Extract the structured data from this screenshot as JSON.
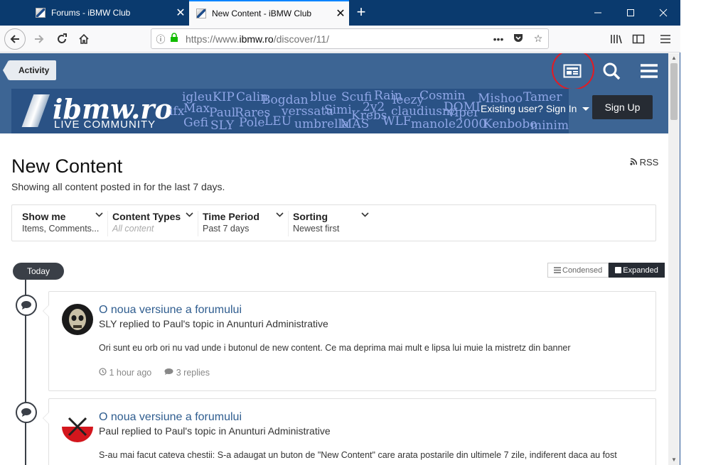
{
  "browser": {
    "tabs": [
      {
        "title": "Forums - iBMW Club",
        "close": "✕"
      },
      {
        "title": "New Content - iBMW Club",
        "close": "✕"
      }
    ],
    "new_tab": "+",
    "window_controls": {
      "minimize": "—",
      "maximize": "☐",
      "close": "✕"
    },
    "url_prefix": "https://www.",
    "url_domain": "ibmw.ro",
    "url_path": "/discover/11/",
    "url_actions": "•••"
  },
  "site": {
    "activity_label": "Activity",
    "logo_text": "ibmw.ro",
    "logo_sub": "LIVE COMMUNITY",
    "nicks": [
      "igleu",
      "KIP",
      "Calin",
      "Bogdan",
      "blue",
      "Scufi",
      "Rain",
      "leezy",
      "Cosmin",
      "Mishoo",
      "Tamer",
      "ifx",
      "Max",
      "Paul",
      "Rares",
      "verssatu",
      "Simi",
      "2y2",
      "claudiusnc",
      "DOMI",
      "viper",
      "Gefi",
      "SLY",
      "Pole",
      "LEU",
      "umbrella",
      "MAS",
      "Krebs",
      "WLF",
      "manole2000",
      "Kenbobo",
      "minima"
    ],
    "signin_label": "Existing user? Sign In",
    "signup_label": "Sign Up"
  },
  "page": {
    "title": "New Content",
    "subtitle": "Showing all content posted in for the last 7 days.",
    "rss_label": "RSS",
    "filters": [
      {
        "title": "Show me",
        "value": "Items, Comments..."
      },
      {
        "title": "Content Types",
        "value": "All content"
      },
      {
        "title": "Time Period",
        "value": "Past 7 days"
      },
      {
        "title": "Sorting",
        "value": "Newest first"
      }
    ],
    "today_label": "Today",
    "view_condensed": "Condensed",
    "view_expanded": "Expanded"
  },
  "posts": [
    {
      "title": "O noua versiune a forumului",
      "meta": "SLY replied to Paul's topic in Anunturi Administrative",
      "body": "Ori sunt eu orb ori nu vad unde i butonul de new content. Ce ma deprima mai mult e lipsa lui muie la mistretz din banner",
      "time": "1 hour ago",
      "replies": "3 replies"
    },
    {
      "title": "O noua versiune a forumului",
      "meta": "Paul replied to Paul's topic in Anunturi Administrative",
      "body": "S-au mai facut cateva chestii: S-a adaugat un buton de \"New Content\" care arata postarile din ultimele 7 zile, indiferent daca au fost"
    }
  ],
  "colors": {
    "header_blue": "#3d6594",
    "link_blue": "#2f5d8f",
    "annotation_red": "#e31b23",
    "dark": "#262b33"
  }
}
